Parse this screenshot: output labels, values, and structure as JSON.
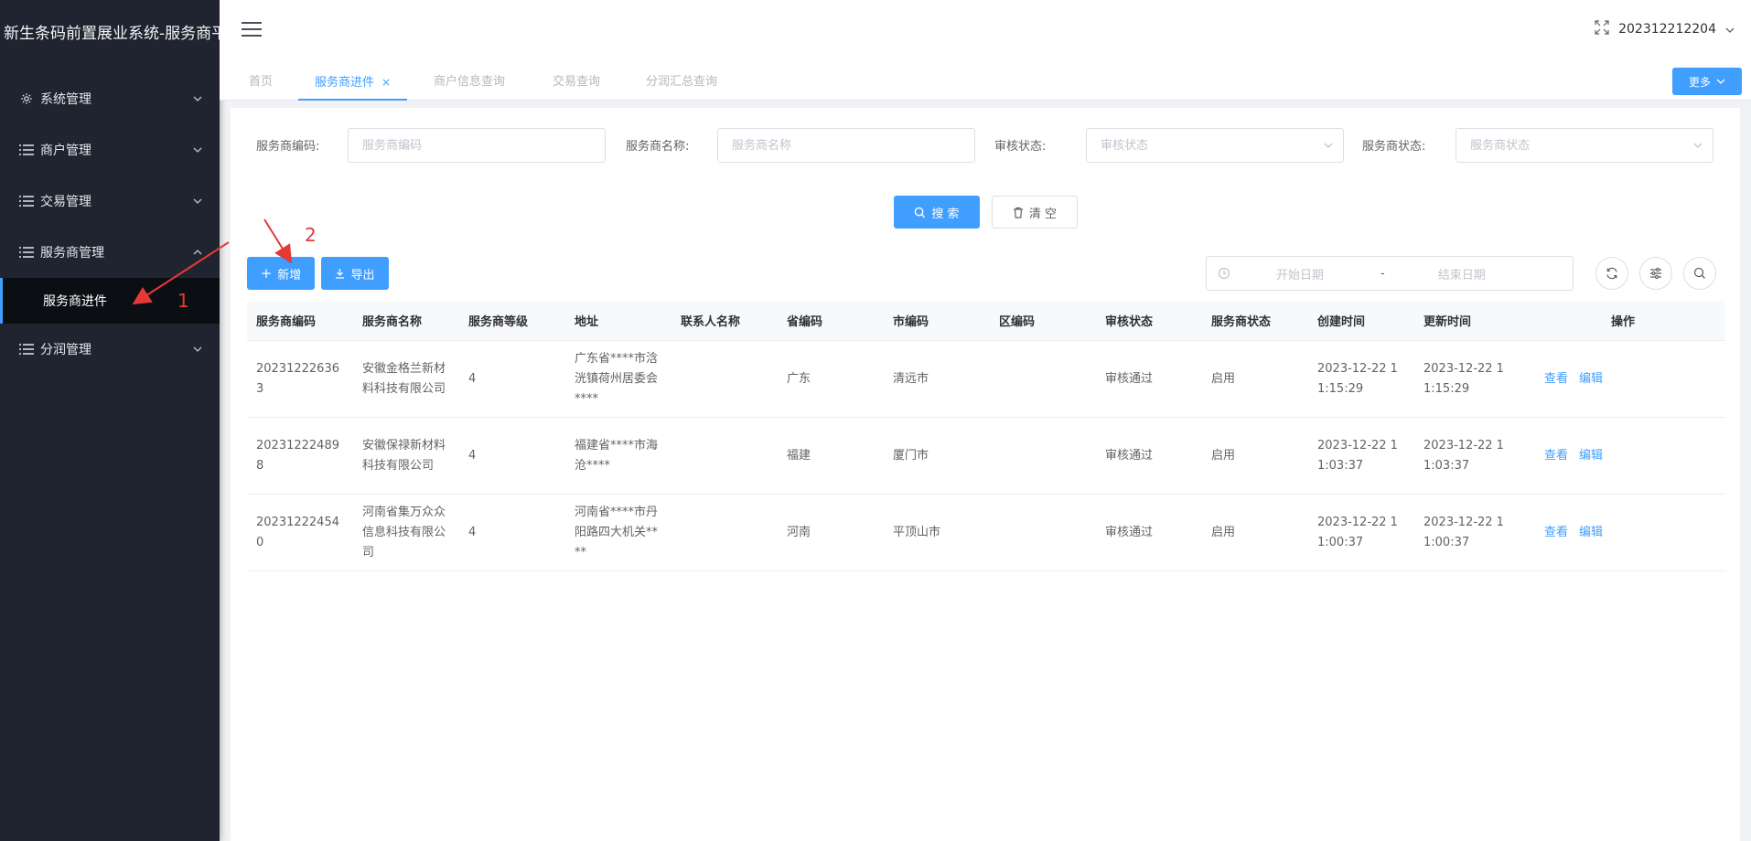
{
  "app": {
    "title": "新生条码前置展业系统-服务商平"
  },
  "sidebar": {
    "items": [
      {
        "label": "系统管理",
        "icon": "gear-icon",
        "expanded": false
      },
      {
        "label": "商户管理",
        "icon": "list-icon",
        "expanded": false
      },
      {
        "label": "交易管理",
        "icon": "list-icon",
        "expanded": false
      },
      {
        "label": "服务商管理",
        "icon": "list-icon",
        "expanded": true
      },
      {
        "label": "分润管理",
        "icon": "list-icon",
        "expanded": false
      }
    ],
    "submenu": {
      "label": "服务商进件"
    }
  },
  "header": {
    "username": "202312212204"
  },
  "tabs": [
    {
      "label": "首页"
    },
    {
      "label": "服务商进件",
      "active": true,
      "close": "×"
    },
    {
      "label": "商户信息查询"
    },
    {
      "label": "交易查询"
    },
    {
      "label": "分润汇总查询"
    }
  ],
  "more_button": {
    "label": "更多"
  },
  "filters": {
    "code": {
      "label": "服务商编码:",
      "placeholder": "服务商编码"
    },
    "name": {
      "label": "服务商名称:",
      "placeholder": "服务商名称"
    },
    "audit": {
      "label": "审核状态:",
      "placeholder": "审核状态"
    },
    "status": {
      "label": "服务商状态:",
      "placeholder": "服务商状态"
    }
  },
  "buttons": {
    "search": "搜 索",
    "clear": "清 空",
    "add": "新增",
    "export": "导出"
  },
  "date_range": {
    "start": "开始日期",
    "sep": "-",
    "end": "结束日期"
  },
  "table": {
    "headers": [
      "服务商编码",
      "服务商名称",
      "服务商等级",
      "地址",
      "联系人名称",
      "省编码",
      "市编码",
      "区编码",
      "审核状态",
      "服务商状态",
      "创建时间",
      "更新时间",
      "操作"
    ],
    "rows": [
      {
        "code": "202312226363",
        "name": "安徽金格兰新材料科技有限公司",
        "level": "4",
        "address": "广东省****市浛洸镇荷州居委会****",
        "contact": "",
        "province": "广东",
        "city": "清远市",
        "district": "",
        "audit": "审核通过",
        "status": "启用",
        "created": "2023-12-22 11:15:29",
        "updated": "2023-12-22 11:15:29",
        "view": "查看",
        "edit": "编辑"
      },
      {
        "code": "202312224898",
        "name": "安徽保禄新材料科技有限公司",
        "level": "4",
        "address": "福建省****市海沧****",
        "contact": "",
        "province": "福建",
        "city": "厦门市",
        "district": "",
        "audit": "审核通过",
        "status": "启用",
        "created": "2023-12-22 11:03:37",
        "updated": "2023-12-22 11:03:37",
        "view": "查看",
        "edit": "编辑"
      },
      {
        "code": "202312224540",
        "name": "河南省集万众众信息科技有限公司",
        "level": "4",
        "address": "河南省****市丹阳路四大机关****",
        "contact": "",
        "province": "河南",
        "city": "平顶山市",
        "district": "",
        "audit": "审核通过",
        "status": "启用",
        "created": "2023-12-22 11:00:37",
        "updated": "2023-12-22 11:00:37",
        "view": "查看",
        "edit": "编辑"
      }
    ]
  },
  "annotations": {
    "one": "1",
    "two": "2"
  },
  "colors": {
    "sidebar_bg": "#1f2430",
    "primary": "#409eff",
    "annotation": "#e53935"
  }
}
